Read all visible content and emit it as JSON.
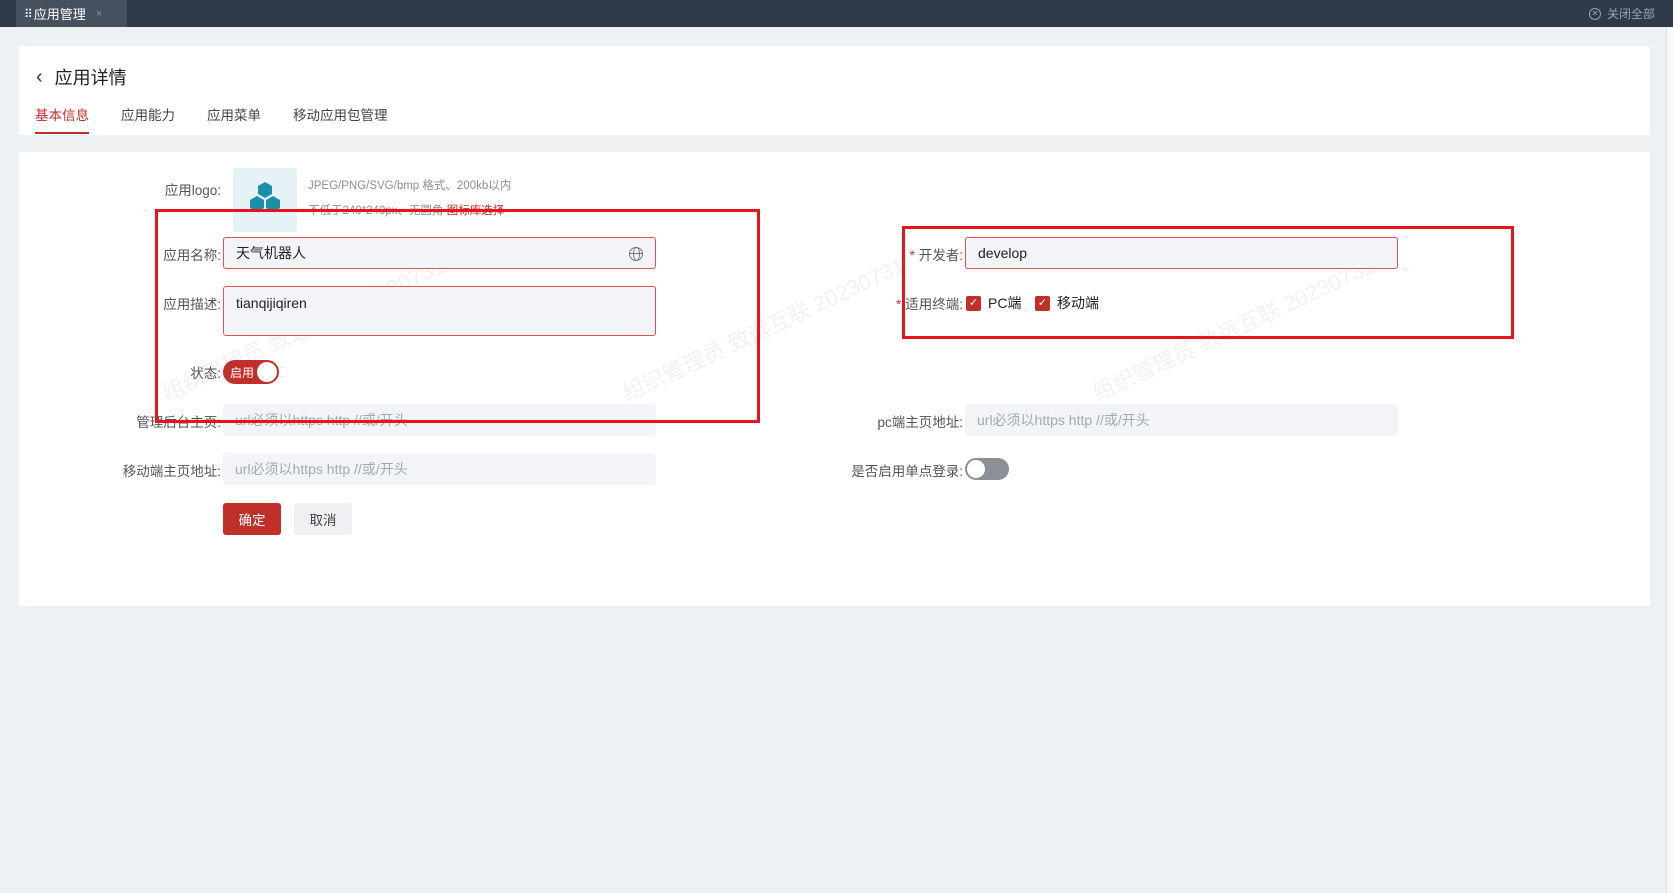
{
  "topbar": {
    "tab_label": "应用管理",
    "tab_close": "×",
    "close_all": "关闭全部"
  },
  "header": {
    "back_icon": "chevron-left-icon",
    "title": "应用详情",
    "tabs": [
      {
        "label": "基本信息",
        "active": true
      },
      {
        "label": "应用能力",
        "active": false
      },
      {
        "label": "应用菜单",
        "active": false
      },
      {
        "label": "移动应用包管理",
        "active": false
      }
    ]
  },
  "form": {
    "logo": {
      "label": "应用logo:",
      "icon": "hexagon-cluster-icon",
      "hint_line1": "JPEG/PNG/SVG/bmp 格式、200kb以内",
      "hint_line2": "不低于240*240px、无圆角",
      "library_link": "图标库选择"
    },
    "app_name": {
      "label": "应用名称:",
      "value": "天气机器人",
      "icon": "globe-icon"
    },
    "app_desc": {
      "label": "应用描述:",
      "value": "tianqijiqiren"
    },
    "status": {
      "label": "状态:",
      "toggle_text": "启用",
      "enabled": true
    },
    "admin_home": {
      "label": "管理后台主页:",
      "placeholder": "url必须以https http //或/开头"
    },
    "mobile_home": {
      "label": "移动端主页地址:",
      "placeholder": "url必须以https http //或/开头"
    },
    "developer": {
      "required": "*",
      "label": "开发者:",
      "value": "develop"
    },
    "terminals": {
      "required": "*",
      "label": "适用终端:",
      "options": [
        {
          "label": "PC端",
          "checked": true
        },
        {
          "label": "移动端",
          "checked": true
        }
      ]
    },
    "pc_home": {
      "label": "pc端主页地址:",
      "placeholder": "url必须以https http //或/开头"
    },
    "sso": {
      "label": "是否启用单点登录:",
      "enabled": false
    },
    "confirm_label": "确定",
    "cancel_label": "取消"
  },
  "watermark": "组织管理员 致远互联 20230731",
  "colors": {
    "accent": "#c0302b",
    "topbar": "#2f3a48",
    "annotation": "#e8141b"
  }
}
